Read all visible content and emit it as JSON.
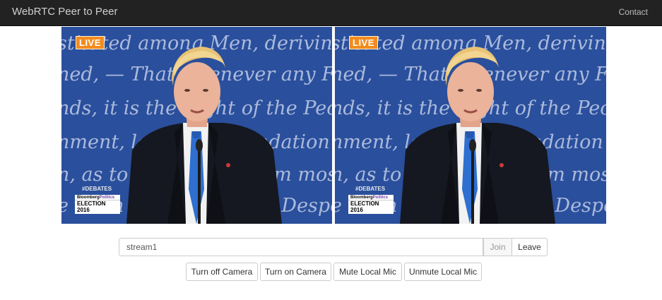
{
  "navbar": {
    "brand": "WebRTC Peer to Peer",
    "contact": "Contact"
  },
  "videos": [
    {
      "name": "local",
      "live": "LIVE",
      "hashtag": "#DEBATES",
      "logo_a": "Bloomberg",
      "logo_b": "Politics",
      "election": "ELECTION 2016",
      "backdrop_lines": [
        "stituted among Men, deriving their j",
        "ned, — That whenever any Form of",
        "nds, it is the Right of the People to alter o",
        "nment, laying its foundation on such prin",
        "n, as to them shall seem most likely to eff",
        "e them under absolute Despotism, to throw of"
      ]
    },
    {
      "name": "remote",
      "live": "LIVE",
      "hashtag": "#DEBATES",
      "logo_a": "Bloomberg",
      "logo_b": "Politics",
      "election": "ELECTION 2016",
      "backdrop_lines": [
        "stituted among Men, deriving their j",
        "ned, — That whenever any Form of",
        "nds, it is the Right of the People to alter o",
        "nment, laying its foundation on such prin",
        "n, as to them shall seem most likely to eff",
        "e them under absolute Despotism, to throw of"
      ]
    }
  ],
  "controls": {
    "stream_value": "stream1",
    "join_label": "Join",
    "leave_label": "Leave",
    "turn_off_camera": "Turn off Camera",
    "turn_on_camera": "Turn on Camera",
    "mute_mic": "Mute Local Mic",
    "unmute_mic": "Unmute Local Mic"
  },
  "colors": {
    "navbar": "#222222",
    "backdrop": "#2a4f9c",
    "live": "#f28c1f",
    "tie": "#2e6fd0"
  }
}
